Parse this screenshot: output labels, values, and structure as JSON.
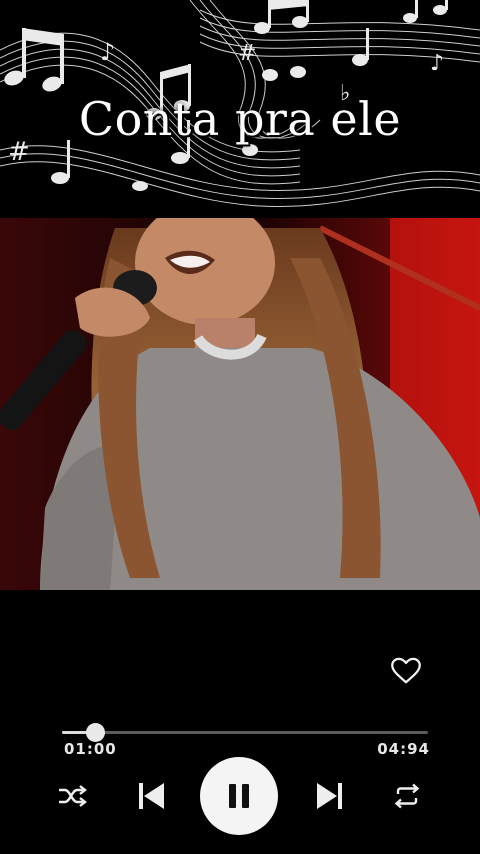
{
  "header": {
    "title": "Conta pra ele"
  },
  "player": {
    "current_time": "01:00",
    "total_time": "04:94",
    "progress": 0.09,
    "liked": false
  },
  "icons": {
    "like": "heart-outline-icon",
    "shuffle": "shuffle-icon",
    "previous": "skip-previous-icon",
    "play_pause": "pause-icon",
    "next": "skip-next-icon",
    "repeat": "repeat-icon"
  },
  "colors": {
    "background": "#000000",
    "accent": "#f4f4f4",
    "track": "#5a5a5a"
  }
}
